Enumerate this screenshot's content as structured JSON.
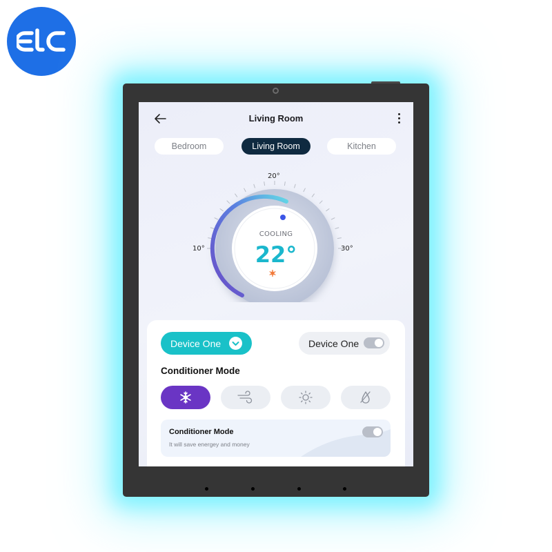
{
  "brand": {
    "logo_text": "ELC",
    "color": "#1e6fe6"
  },
  "device": {
    "glow_color": "#7ff2ff",
    "bezel_color": "#353535"
  },
  "header": {
    "title": "Living Room",
    "back_icon": "arrow-left-icon",
    "menu_icon": "more-vertical-icon"
  },
  "room_tabs": [
    {
      "label": "Bedroom",
      "active": false
    },
    {
      "label": "Living Room",
      "active": true
    },
    {
      "label": "Kitchen",
      "active": false
    }
  ],
  "thermostat": {
    "mode_label": "COOLING",
    "temperature": "22°",
    "mode_icon": "snowflake-icon",
    "scale": {
      "min_label": "10°",
      "mid_label": "20°",
      "max_label": "30°"
    },
    "accent_color": "#1bb7cd"
  },
  "controls": {
    "device_select": {
      "label": "Device One",
      "icon": "chevron-down-icon",
      "color": "#19c1c8"
    },
    "device_toggle": {
      "label": "Device One",
      "on": true
    },
    "section_title": "Conditioner Mode",
    "modes": [
      {
        "name": "cool",
        "icon": "snowflake-icon",
        "active": true
      },
      {
        "name": "fan",
        "icon": "wind-icon",
        "active": false
      },
      {
        "name": "heat",
        "icon": "sun-icon",
        "active": false
      },
      {
        "name": "dry",
        "icon": "droplet-off-icon",
        "active": false
      }
    ],
    "active_mode_color": "#6a35c4",
    "eco_card": {
      "title": "Conditioner Mode",
      "subtitle": "It will save energey and money",
      "on": true
    }
  }
}
